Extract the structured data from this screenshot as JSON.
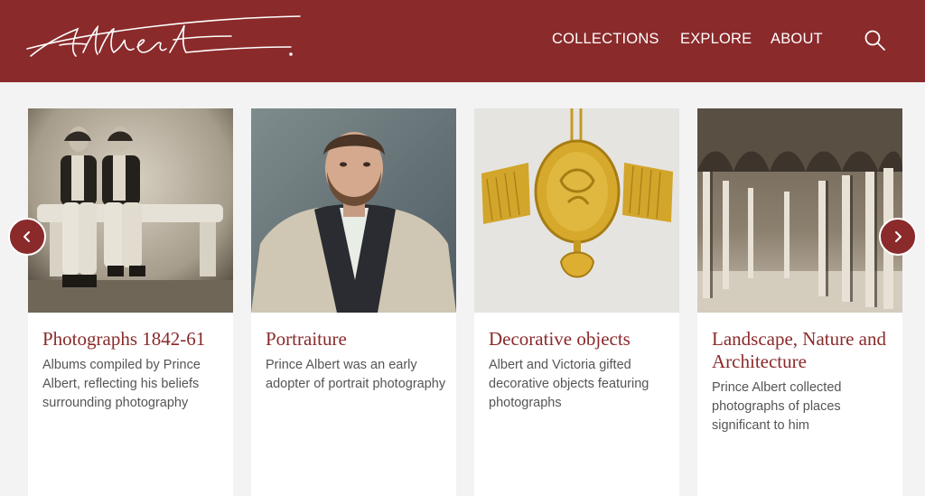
{
  "header": {
    "logo_text": "Albert",
    "nav": [
      "COLLECTIONS",
      "EXPLORE",
      "ABOUT"
    ],
    "search_icon": "search-icon",
    "background": "#8a2a2b"
  },
  "carousel": {
    "prev_icon": "chevron-left-icon",
    "next_icon": "chevron-right-icon",
    "cards": [
      {
        "title": "Photographs 1842-61",
        "description": "Albums compiled by Prince Albert, reflecting his beliefs surrounding photography"
      },
      {
        "title": "Portraiture",
        "description": "Prince Albert was an early adopter of portrait photography"
      },
      {
        "title": "Decorative objects",
        "description": "Albert and Victoria gifted decorative objects featuring photographs"
      },
      {
        "title": "Landscape, Nature and Architecture",
        "description": "Prince Albert collected photographs of places significant to him"
      }
    ]
  },
  "colors": {
    "accent": "#8a2a2b",
    "text": "#555555",
    "page": "#f3f3f3"
  }
}
